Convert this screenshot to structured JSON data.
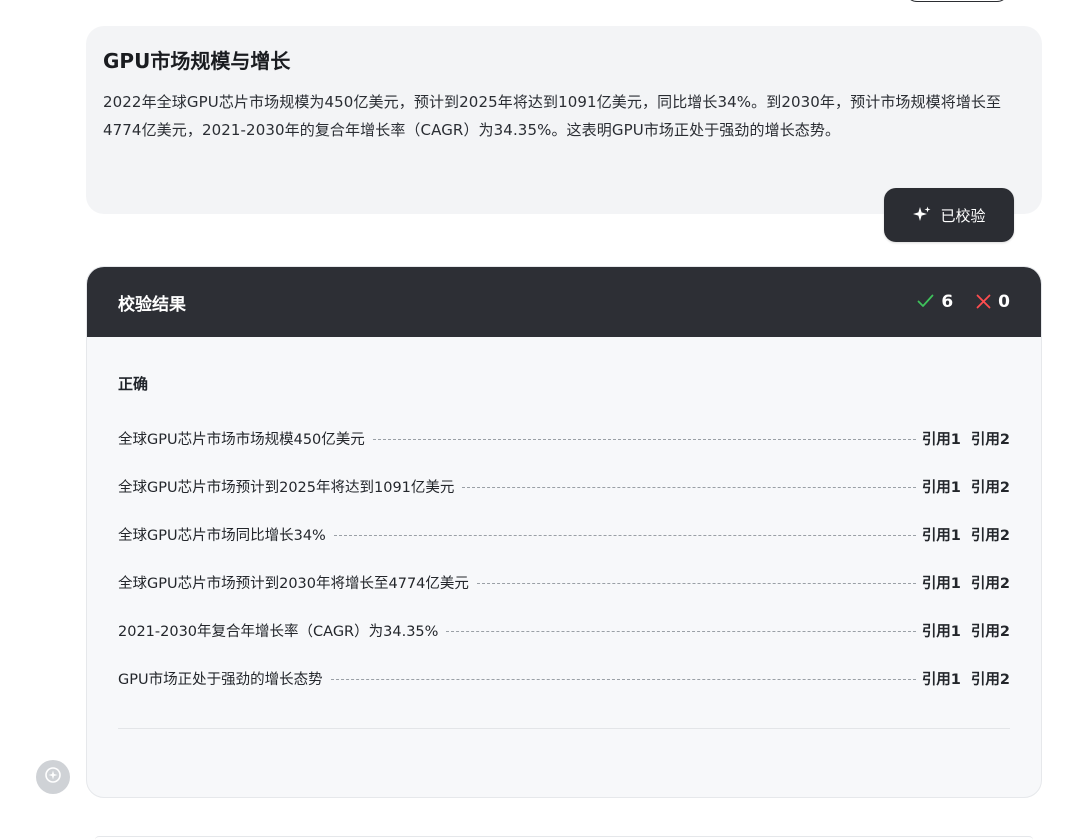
{
  "summary": {
    "title": "GPU市场规模与增长",
    "body": "2022年全球GPU芯片市场规模为450亿美元，预计到2025年将达到1091亿美元，同比增长34%。到2030年，预计市场规模将增长至4774亿美元，2021-2030年的复合年增长率（CAGR）为34.35%。这表明GPU市场正处于强劲的增长态势。"
  },
  "verified_button": {
    "icon": "sparkle-icon",
    "label": "已校验"
  },
  "result": {
    "title": "校验结果",
    "correct_count": "6",
    "wrong_count": "0",
    "section_label": "正确",
    "claims": [
      {
        "text": "全球GPU芯片市场市场规模450亿美元",
        "refs": [
          "引用1",
          "引用2"
        ]
      },
      {
        "text": "全球GPU芯片市场预计到2025年将达到1091亿美元",
        "refs": [
          "引用1",
          "引用2"
        ]
      },
      {
        "text": "全球GPU芯片市场同比增长34%",
        "refs": [
          "引用1",
          "引用2"
        ]
      },
      {
        "text": "全球GPU芯片市场预计到2030年将增长至4774亿美元",
        "refs": [
          "引用1",
          "引用2"
        ]
      },
      {
        "text": "2021-2030年复合年增长率（CAGR）为34.35%",
        "refs": [
          "引用1",
          "引用2"
        ]
      },
      {
        "text": "GPU市场正处于强劲的增长态势",
        "refs": [
          "引用1",
          "引用2"
        ]
      }
    ]
  },
  "colors": {
    "header_bg": "#2d2f35",
    "check_green": "#3ec25b",
    "cross_red": "#ff4d4f"
  }
}
